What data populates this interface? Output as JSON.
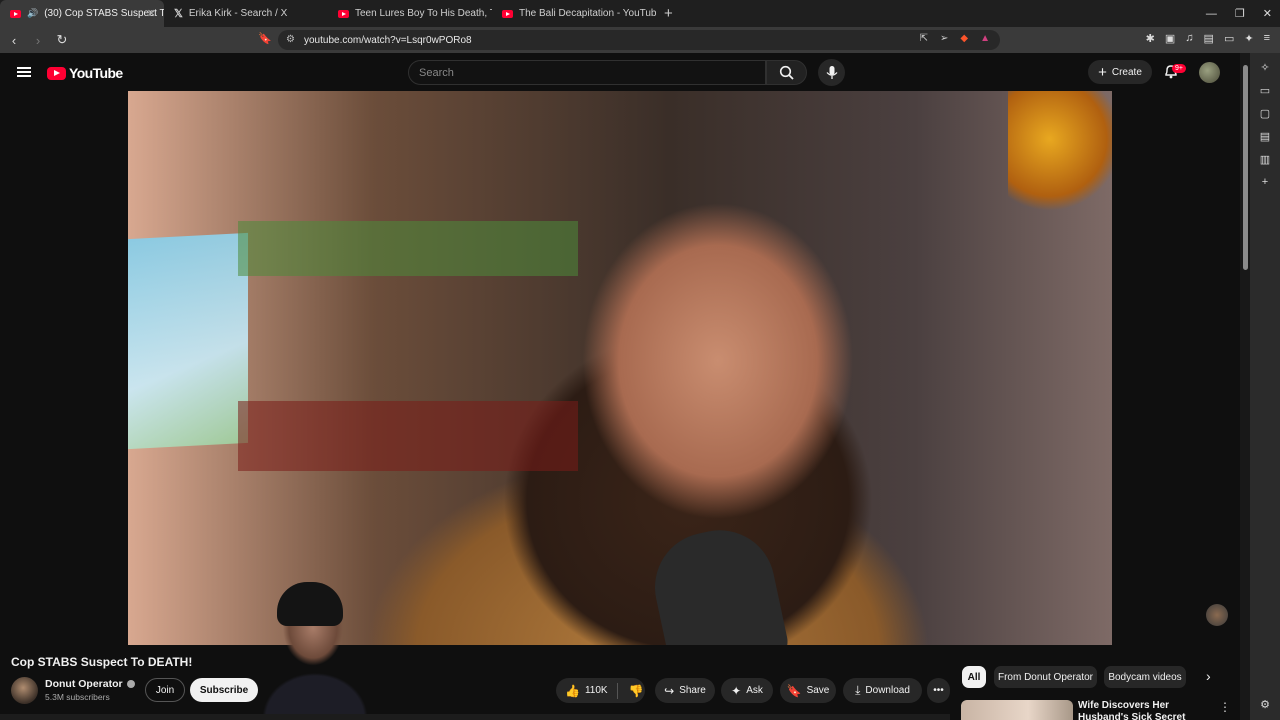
{
  "browser": {
    "tabs": [
      {
        "title": "(30) Cop STABS Suspect T",
        "active": true,
        "icon": "youtube-icon"
      },
      {
        "title": "Erika Kirk - Search / X",
        "active": false,
        "icon": "x-icon"
      },
      {
        "title": "Teen Lures Boy To His Death, Th",
        "active": false,
        "icon": "youtube-icon"
      },
      {
        "title": "The Bali Decapitation - YouTube",
        "active": false,
        "icon": "youtube-icon"
      }
    ],
    "url": "youtube.com/watch?v=Lsqr0wPORo8"
  },
  "youtube": {
    "logo_text": "YouTube",
    "search_placeholder": "Search",
    "create_label": "Create",
    "notifications_badge": "9+"
  },
  "video": {
    "title": "Cop STABS Suspect To DEATH!",
    "channel_name": "Donut Operator",
    "subscribers": "5.3M subscribers",
    "join_label": "Join",
    "subscribe_label": "Subscribe",
    "likes": "110K",
    "share_label": "Share",
    "ask_label": "Ask",
    "save_label": "Save",
    "download_label": "Download"
  },
  "recommendations": {
    "chips": [
      "All",
      "From Donut Operator",
      "Bodycam videos"
    ],
    "first_title": "Wife Discovers Her Husband's Sick Secret"
  },
  "colors": {
    "accent": "#ff0033",
    "background": "#0f0f0f"
  }
}
